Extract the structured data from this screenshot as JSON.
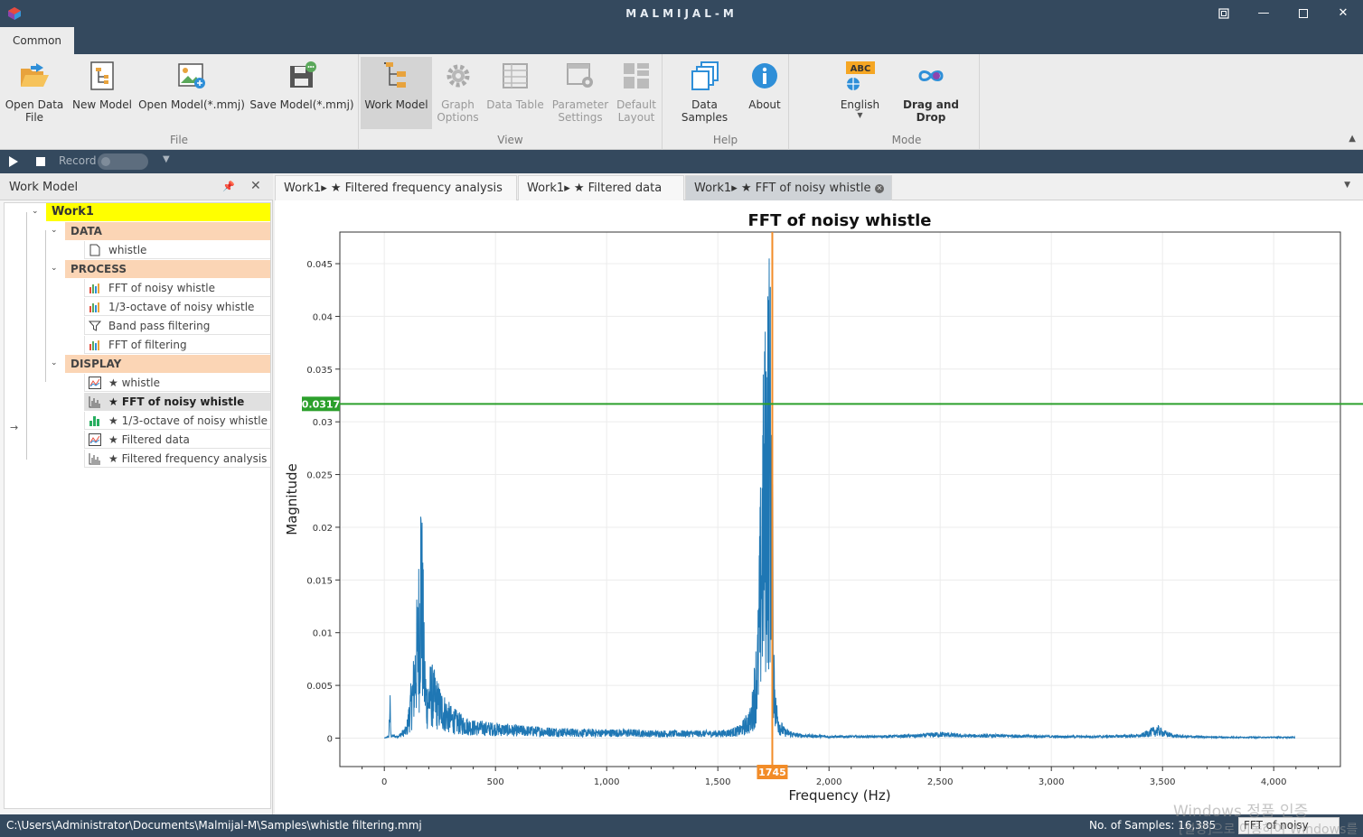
{
  "app": {
    "title": "MALMIJAL-M",
    "window_controls": [
      "restore-layout",
      "minimize",
      "maximize",
      "close"
    ]
  },
  "ribbon": {
    "tab": "Common",
    "groups": [
      {
        "label": "File",
        "buttons": [
          {
            "label": "Open Data\nFile",
            "icon": "folder-open-icon"
          },
          {
            "label": "New Model",
            "icon": "new-model-icon"
          },
          {
            "label": "Open Model(*.mmj)",
            "icon": "open-model-icon"
          },
          {
            "label": "Save Model(*.mmj)",
            "icon": "save-model-icon"
          }
        ]
      },
      {
        "label": "View",
        "buttons": [
          {
            "label": "Work Model",
            "icon": "work-model-icon",
            "state": "active"
          },
          {
            "label": "Graph\nOptions",
            "icon": "gear-icon",
            "state": "disabled"
          },
          {
            "label": "Data Table",
            "icon": "table-icon",
            "state": "disabled"
          },
          {
            "label": "Parameter\nSettings",
            "icon": "settings-window-icon",
            "state": "disabled"
          },
          {
            "label": "Default\nLayout",
            "icon": "layout-icon",
            "state": "disabled"
          }
        ]
      },
      {
        "label": "Help",
        "buttons": [
          {
            "label": "Data Samples",
            "icon": "stack-icon"
          },
          {
            "label": "About",
            "icon": "info-icon"
          }
        ]
      },
      {
        "label": "Mode",
        "buttons": [
          {
            "label": "English",
            "icon": "language-icon",
            "badge": "ABC"
          },
          {
            "label": "Drag and Drop",
            "icon": "infinity-icon"
          }
        ]
      }
    ]
  },
  "recordbar": {
    "record_label": "Record"
  },
  "left_panel": {
    "title": "Work Model",
    "tree": {
      "work": "Work1",
      "categories": [
        {
          "label": "DATA",
          "items": [
            {
              "label": "whistle",
              "icon": "file-icon"
            }
          ]
        },
        {
          "label": "PROCESS",
          "items": [
            {
              "label": "FFT of noisy whistle",
              "icon": "color-bars-icon"
            },
            {
              "label": "1/3-octave of noisy whistle",
              "icon": "color-bars-icon"
            },
            {
              "label": "Band pass filtering",
              "icon": "filter-icon"
            },
            {
              "label": "FFT of filtering",
              "icon": "color-bars-icon"
            }
          ]
        },
        {
          "label": "DISPLAY",
          "items": [
            {
              "label": "★ whistle",
              "icon": "line-chart-icon"
            },
            {
              "label": "★ FFT of noisy whistle",
              "icon": "spectrum-icon",
              "selected": true
            },
            {
              "label": "★ 1/3-octave of noisy whistle",
              "icon": "green-bars-icon"
            },
            {
              "label": "★ Filtered data",
              "icon": "line-chart-icon"
            },
            {
              "label": "★ Filtered frequency analysis",
              "icon": "spectrum-icon"
            }
          ]
        }
      ]
    }
  },
  "doc_tabs": [
    {
      "label": "Work1▸ ★ Filtered frequency analysis"
    },
    {
      "label": "Work1▸ ★ Filtered data"
    },
    {
      "label": "Work1▸ ★ FFT of noisy whistle",
      "active": true
    }
  ],
  "chart_data": {
    "type": "line",
    "title": "FFT of noisy whistle",
    "xlabel": "Frequency (Hz)",
    "ylabel": "Magnitude",
    "xlim": [
      -200,
      4300
    ],
    "ylim": [
      -0.0027,
      0.048
    ],
    "x_ticks": [
      0,
      500,
      1000,
      1500,
      2000,
      2500,
      3000,
      3500,
      4000
    ],
    "x_tick_labels": [
      "0",
      "500",
      "1,000",
      "1,500",
      "2,000",
      "2,500",
      "3,000",
      "3,500",
      "4,000"
    ],
    "y_ticks": [
      0,
      0.005,
      0.01,
      0.015,
      0.02,
      0.025,
      0.03,
      0.035,
      0.04,
      0.045
    ],
    "y_tick_labels": [
      "0",
      "0.005",
      "0.01",
      "0.015",
      "0.02",
      "0.025",
      "0.03",
      "0.035",
      "0.04",
      "0.045"
    ],
    "grid": true,
    "legend": "none",
    "series_color": "#1f77b4",
    "cursor": {
      "x": 1745,
      "y": 0.0317,
      "x_label": "1745",
      "y_label": "0.0317",
      "x_color": "#f28c28",
      "y_color": "#2ca02c"
    },
    "series": [
      {
        "x": [
          0,
          20,
          25,
          30,
          60,
          100,
          130,
          150,
          160,
          165,
          170,
          175,
          180,
          190,
          210,
          250,
          300,
          350,
          400,
          500,
          600,
          700,
          800,
          900,
          1000,
          1100,
          1200,
          1300,
          1400,
          1500,
          1550,
          1600,
          1650,
          1680,
          1700,
          1720,
          1730,
          1740,
          1745,
          1750,
          1760,
          1780,
          1800,
          1850,
          1900,
          2000,
          2200,
          2400,
          2500,
          2600,
          2800,
          3000,
          3200,
          3400,
          3450,
          3480,
          3500,
          3550,
          3600,
          3800,
          4000,
          4096
        ],
        "y": [
          0,
          0.0002,
          0.0043,
          0.0003,
          0.0002,
          0.001,
          0.006,
          0.012,
          0.0165,
          0.0222,
          0.0175,
          0.013,
          0.008,
          0.0045,
          0.006,
          0.004,
          0.0025,
          0.0018,
          0.0014,
          0.0012,
          0.001,
          0.0009,
          0.0008,
          0.0007,
          0.0007,
          0.0007,
          0.0006,
          0.0006,
          0.0006,
          0.0006,
          0.0007,
          0.001,
          0.0025,
          0.0095,
          0.0265,
          0.0355,
          0.039,
          0.0338,
          0.0255,
          0.0105,
          0.0035,
          0.0015,
          0.0008,
          0.0004,
          0.0003,
          0.0002,
          0.0002,
          0.0003,
          0.0005,
          0.0003,
          0.0003,
          0.0002,
          0.0002,
          0.0003,
          0.0008,
          0.001,
          0.0007,
          0.0003,
          0.0002,
          0.0001,
          0.0001,
          0.0001
        ]
      }
    ]
  },
  "statusbar": {
    "path": "C:\\Users\\Administrator\\Documents\\Malmijal-M\\Samples\\whistle filtering.mmj",
    "samples": "No. of Samples: 16,385",
    "chip": "FFT of noisy",
    "watermark_line1": "Windows 정품 인증",
    "watermark_line2": "[설정]으로 이동하여 Windows를"
  },
  "colors": {
    "titlebar": "#34495e",
    "ribbon": "#ececec",
    "work_highlight": "#ffff00",
    "category_highlight": "#fbd5b5"
  }
}
